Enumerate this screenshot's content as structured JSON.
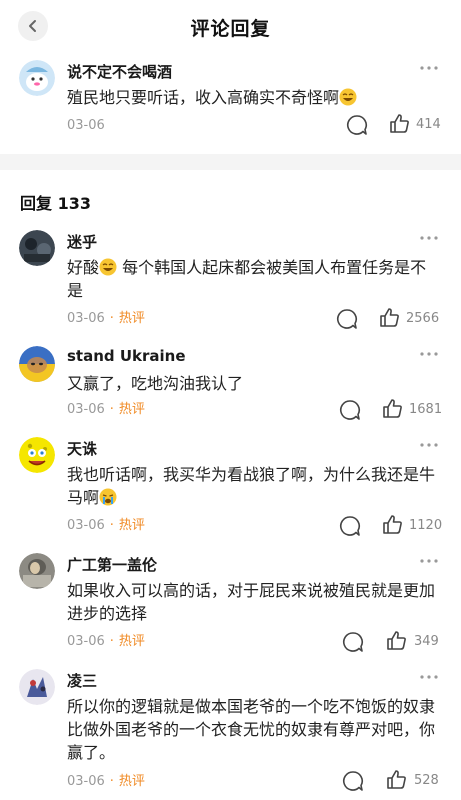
{
  "header": {
    "title": "评论回复"
  },
  "main_comment": {
    "username": "说不定不会喝酒",
    "text": "殖民地只要听话，收入高确实不奇怪啊",
    "date": "03-06",
    "likes": "414"
  },
  "replies": {
    "label": "回复 133",
    "items": [
      {
        "username": "迷乎",
        "text_a": "好酸",
        "text_b": " 每个韩国人起床都会被美国人布置任务是不是",
        "date": "03-06",
        "hot": "热评",
        "likes": "2566"
      },
      {
        "username": "stand Ukraine",
        "text": "又赢了，吃地沟油我认了",
        "date": "03-06",
        "hot": "热评",
        "likes": "1681"
      },
      {
        "username": "天诛",
        "text": "我也听话啊，我买华为看战狼了啊，为什么我还是牛马啊",
        "date": "03-06",
        "hot": "热评",
        "likes": "1120"
      },
      {
        "username": "广工第一盖伦",
        "text": "如果收入可以高的话，对于屁民来说被殖民就是更加进步的选择",
        "date": "03-06",
        "hot": "热评",
        "likes": "349"
      },
      {
        "username": "凌三",
        "text": "所以你的逻辑就是做本国老爷的一个吃不饱饭的奴隶比做外国老爷的一个衣食无忧的奴隶有尊严对吧，你赢了。",
        "date": "03-06",
        "hot": "热评",
        "likes": "528"
      }
    ]
  },
  "colors": {
    "hot": "#f08a24",
    "meta": "#999999",
    "divider": "#f4f4f4"
  },
  "icons": [
    "chevron-left-icon",
    "more-icon",
    "comment-icon",
    "thumbs-up-icon",
    "laugh-emoji",
    "crying-emoji"
  ]
}
